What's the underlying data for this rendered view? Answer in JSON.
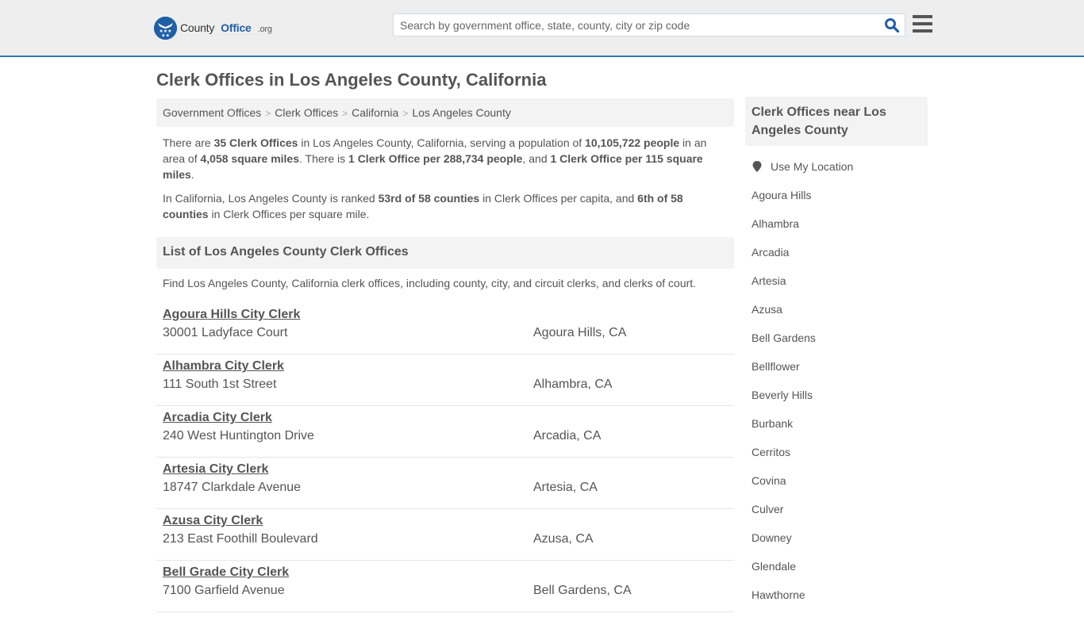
{
  "header": {
    "logo": {
      "county": "County",
      "office": "Office",
      "org": ".org"
    },
    "search": {
      "placeholder": "Search by government office, state, county, city or zip code",
      "value": ""
    },
    "search_icon": "search-icon",
    "menu_icon": "hamburger-menu-icon",
    "colors": {
      "brand": "#1f5fa6",
      "header_bg": "#eeeeee",
      "accent_border": "#2f78b7"
    }
  },
  "page": {
    "title": "Clerk Offices in Los Angeles County, California"
  },
  "breadcrumb": [
    {
      "label": "Government Offices"
    },
    {
      "label": "Clerk Offices"
    },
    {
      "label": "California"
    },
    {
      "label": "Los Angeles County"
    }
  ],
  "intro": {
    "p1": {
      "t1": "There are ",
      "b1": "35 Clerk Offices",
      "t2": " in Los Angeles County, California, serving a population of ",
      "b2": "10,105,722 people",
      "t3": " in an area of ",
      "b3": "4,058 square miles",
      "t4": ". There is ",
      "b4": "1 Clerk Office per 288,734 people",
      "t5": ", and ",
      "b5": "1 Clerk Office per 115 square miles",
      "t6": "."
    },
    "p2": {
      "t1": "In California, Los Angeles County is ranked ",
      "b1": "53rd of 58 counties",
      "t2": " in Clerk Offices per capita, and ",
      "b2": "6th of 58 counties",
      "t3": " in Clerk Offices per square mile."
    }
  },
  "list": {
    "heading": "List of Los Angeles County Clerk Offices",
    "description": "Find Los Angeles County, California clerk offices, including county, city, and circuit clerks, and clerks of court.",
    "offices": [
      {
        "name": "Agoura Hills City Clerk",
        "address": "30001 Ladyface Court",
        "city": "Agoura Hills, CA"
      },
      {
        "name": "Alhambra City Clerk",
        "address": "111 South 1st Street",
        "city": "Alhambra, CA"
      },
      {
        "name": "Arcadia City Clerk",
        "address": "240 West Huntington Drive",
        "city": "Arcadia, CA"
      },
      {
        "name": "Artesia City Clerk",
        "address": "18747 Clarkdale Avenue",
        "city": "Artesia, CA"
      },
      {
        "name": "Azusa City Clerk",
        "address": "213 East Foothill Boulevard",
        "city": "Azusa, CA"
      },
      {
        "name": "Bell Grade City Clerk",
        "address": "7100 Garfield Avenue",
        "city": "Bell Gardens, CA"
      }
    ]
  },
  "sidebar": {
    "heading": "Clerk Offices near Los Angeles County",
    "use_location": "Use My Location",
    "location_icon": "map-marker-icon",
    "cities": [
      "Agoura Hills",
      "Alhambra",
      "Arcadia",
      "Artesia",
      "Azusa",
      "Bell Gardens",
      "Bellflower",
      "Beverly Hills",
      "Burbank",
      "Cerritos",
      "Covina",
      "Culver",
      "Downey",
      "Glendale",
      "Hawthorne"
    ]
  }
}
